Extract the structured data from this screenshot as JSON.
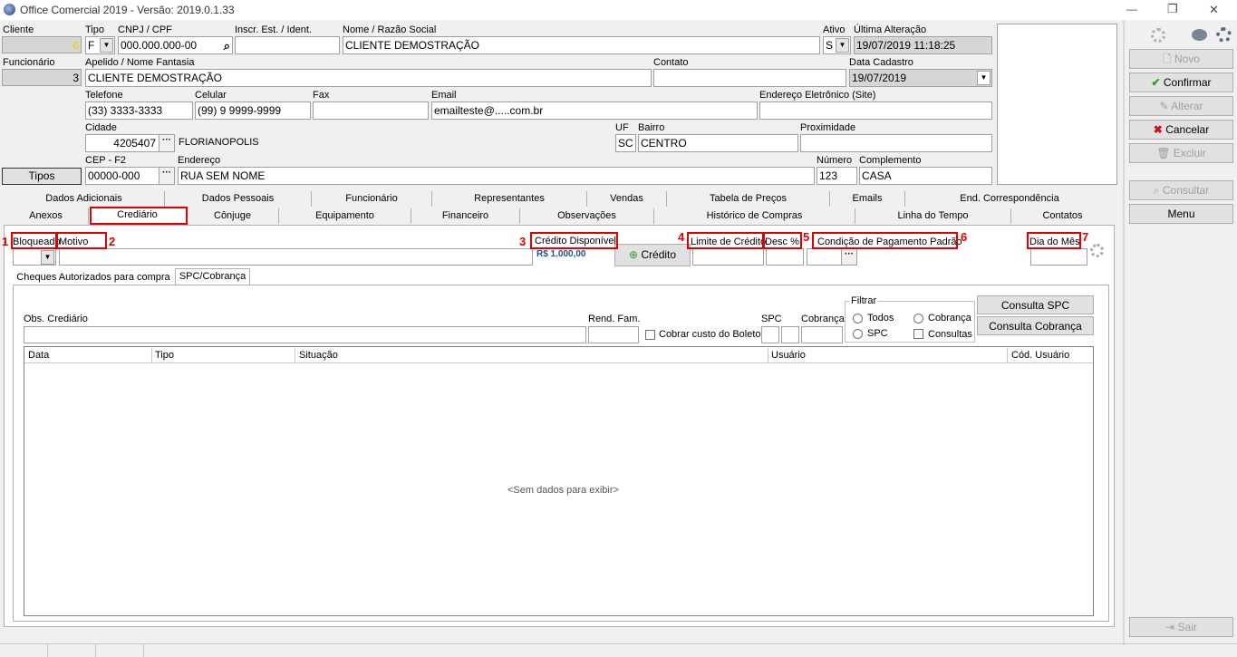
{
  "window": {
    "title": "Office Comercial 2019 - Versão: 2019.0.1.33",
    "min": "—",
    "max": "❐",
    "close": "✕"
  },
  "left": {
    "cliente_label": "Cliente",
    "cliente_value": "6",
    "funcionario_label": "Funcionário",
    "funcionario_value": "3",
    "tipos_button": "Tipos"
  },
  "form": {
    "tipo_label": "Tipo",
    "tipo_value": "F",
    "cnpj_label": "CNPJ / CPF",
    "cnpj_value": "000.000.000-00",
    "inscr_label": "Inscr. Est. / Ident.",
    "inscr_value": "",
    "nome_label": "Nome / Razão Social",
    "nome_value": "CLIENTE DEMOSTRAÇÃO",
    "ativo_label": "Ativo",
    "ativo_value": "S",
    "ultima_label": "Última Alteração",
    "ultima_value": "19/07/2019 11:18:25",
    "apelido_label": "Apelido / Nome Fantasia",
    "apelido_value": "CLIENTE DEMOSTRAÇÃO",
    "contato_label": "Contato",
    "contato_value": "",
    "cadastro_label": "Data Cadastro",
    "cadastro_value": "19/07/2019",
    "telefone_label": "Telefone",
    "telefone_value": "(33) 3333-3333",
    "celular_label": "Celular",
    "celular_value": "(99) 9 9999-9999",
    "fax_label": "Fax",
    "fax_value": "",
    "email_label": "Email",
    "email_value": "emailteste@.....com.br",
    "site_label": "Endereço Eletrônico (Site)",
    "site_value": "",
    "cidade_label": "Cidade",
    "cidade_code": "4205407",
    "cidade_name": "FLORIANOPOLIS",
    "uf_label": "UF",
    "uf_value": "SC",
    "bairro_label": "Bairro",
    "bairro_value": "CENTRO",
    "proximidade_label": "Proximidade",
    "proximidade_value": "",
    "cep_label": "CEP - F2",
    "cep_value": "00000-000",
    "endereco_label": "Endereço",
    "endereco_value": "RUA SEM NOME",
    "numero_label": "Número",
    "numero_value": "123",
    "complemento_label": "Complemento",
    "complemento_value": "CASA"
  },
  "right_buttons": {
    "novo": "Novo",
    "confirmar": "Confirmar",
    "alterar": "Alterar",
    "cancelar": "Cancelar",
    "excluir": "Excluir",
    "consultar": "Consultar",
    "menu": "Menu",
    "sair": "Sair"
  },
  "tabs_row1": [
    "Dados Adicionais",
    "Dados Pessoais",
    "Funcionário",
    "Representantes",
    "Vendas",
    "Tabela de Preços",
    "Emails",
    "End. Correspondência"
  ],
  "tabs_row2": [
    "Anexos",
    "Crediário",
    "Cônjuge",
    "Equipamento",
    "Financeiro",
    "Observações",
    "Histórico de Compras",
    "Linha do Tempo",
    "Contatos"
  ],
  "crediario": {
    "bloqueado_label": "Bloqueado",
    "motivo_label": "Motivo",
    "credito_disp_label": "Crédito Disponível",
    "credito_disp_value": "R$ 1.000,00",
    "credito_button": "Crédito",
    "limite_label": "Limite de Crédito",
    "desc_label": "Desc %",
    "condicao_label": "Condição de Pagamento Padrão",
    "dia_label": "Dia do Mês",
    "subtabs": [
      "Cheques Autorizados para compra",
      "SPC/Cobrança"
    ],
    "obs_label": "Obs. Crediário",
    "rend_label": "Rend. Fam.",
    "cobrar_label": "Cobrar custo do Boleto",
    "spc_label": "SPC",
    "cobranca_label": "Cobrança",
    "filtrar_label": "Filtrar",
    "f_todos": "Todos",
    "f_cobranca": "Cobrança",
    "f_spc": "SPC",
    "f_consultas": "Consultas",
    "consulta_spc_button": "Consulta SPC",
    "consulta_cobranca_button": "Consulta Cobrança",
    "grid_columns": [
      "Data",
      "Tipo",
      "Situação",
      "Usuário",
      "Cód. Usuário"
    ],
    "empty_text": "<Sem dados para exibir>"
  },
  "annotations": [
    "1",
    "2",
    "3",
    "4",
    "5",
    "6",
    "7"
  ]
}
